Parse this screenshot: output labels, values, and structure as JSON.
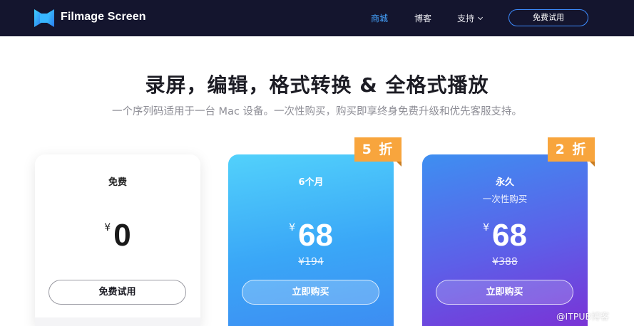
{
  "nav": {
    "brand": "Filmage Screen",
    "links": [
      "商城",
      "博客",
      "支持"
    ],
    "trial_button": "免费试用"
  },
  "hero": {
    "title": "录屏，编辑，格式转换 & 全格式播放",
    "subtitle": "一个序列码适用于一台 Mac 设备。一次性购买，购买即享终身免费升级和优先客服支持。"
  },
  "plans": [
    {
      "title": "免费",
      "subtitle": "",
      "currency": "¥",
      "price": "0",
      "old_price": "",
      "button": "免费试用",
      "badge": ""
    },
    {
      "title": "6个月",
      "subtitle": "",
      "currency": "¥",
      "price": "68",
      "old_price": "¥194",
      "button": "立即购买",
      "badge": "5 折"
    },
    {
      "title": "永久",
      "subtitle": "一次性购买",
      "currency": "¥",
      "price": "68",
      "old_price": "¥388",
      "button": "立即购买",
      "badge": "2 折"
    }
  ],
  "watermark": "@ITPUB博客",
  "colors": {
    "navbar_bg": "#14152e",
    "accent": "#45a3ff",
    "badge": "#f8a53d",
    "card_six_gradient": [
      "#52d1fb",
      "#3d8df2"
    ],
    "card_life_gradient": [
      "#3e8ff1",
      "#7a33d6"
    ]
  },
  "icons": {
    "logo": "filmage-logo-icon",
    "support_chevron": "chevron-down-icon"
  }
}
